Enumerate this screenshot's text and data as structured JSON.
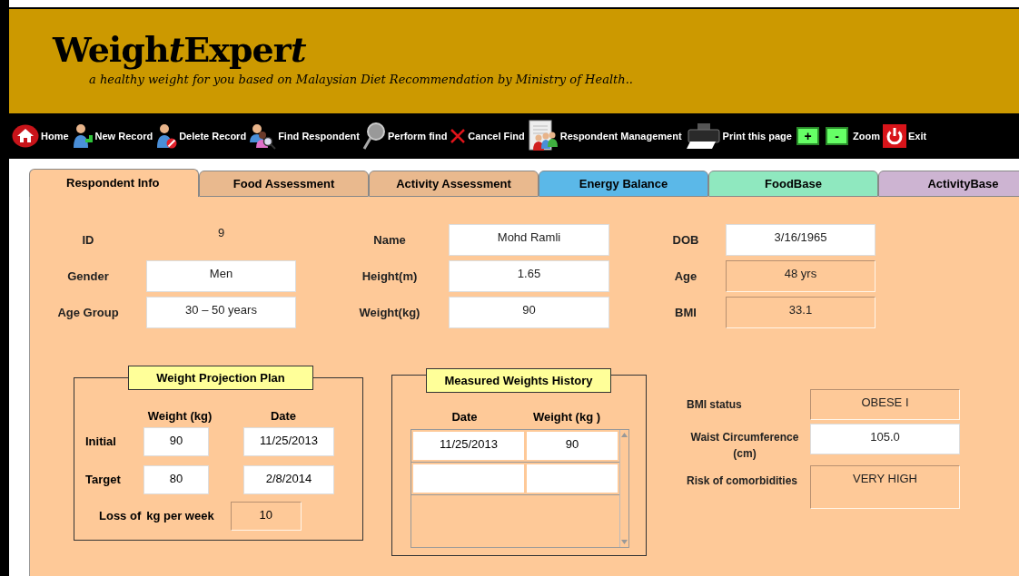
{
  "header": {
    "title_parts": [
      {
        "text": "Weigh",
        "italic": false
      },
      {
        "text": "t",
        "italic": true
      },
      {
        "text": "Exper",
        "italic": false
      },
      {
        "text": "t",
        "italic": true
      }
    ],
    "tagline": "a healthy weight for you based on Malaysian Diet Recommendation by Ministry of Health.."
  },
  "toolbar": [
    {
      "kind": "home",
      "label": "Home"
    },
    {
      "kind": "new",
      "label": "New Record"
    },
    {
      "kind": "delete",
      "label": "Delete Record"
    },
    {
      "kind": "find",
      "label": "Find Respondent"
    },
    {
      "kind": "perform",
      "label": "Perform find"
    },
    {
      "kind": "cancel",
      "label": "Cancel Find"
    },
    {
      "kind": "manage",
      "label": "Respondent Management"
    },
    {
      "kind": "print",
      "label": "Print this page"
    },
    {
      "kind": "zoom-in",
      "label": "+"
    },
    {
      "kind": "zoom-out",
      "label": "-"
    },
    {
      "kind": "text",
      "label": "Zoom"
    },
    {
      "kind": "exit",
      "label": "Exit"
    }
  ],
  "tabs": [
    {
      "label": "Respondent Info",
      "selected": true,
      "color": "#fec998"
    },
    {
      "label": "Food Assessment",
      "selected": false,
      "color": "#e9b98e"
    },
    {
      "label": "Activity Assessment",
      "selected": false,
      "color": "#e9b98e"
    },
    {
      "label": "Energy Balance",
      "selected": false,
      "color": "#5bb8e8"
    },
    {
      "label": "FoodBase",
      "selected": false,
      "color": "#8fe8bf"
    },
    {
      "label": "ActivityBase",
      "selected": false,
      "color": "#cdb4d2"
    }
  ],
  "respondent": [
    [
      {
        "label": "ID",
        "value": "9",
        "kind": "plain"
      },
      {
        "label": "Gender",
        "value": "Men",
        "kind": "input"
      },
      {
        "label": "Age Group",
        "value": "30 – 50 years",
        "kind": "input"
      }
    ],
    [
      {
        "label": "Name",
        "value": "Mohd Ramli",
        "kind": "input"
      },
      {
        "label": "Height(m)",
        "value": "1.65",
        "kind": "input"
      },
      {
        "label": "Weight(kg)",
        "value": "90",
        "kind": "input"
      }
    ],
    [
      {
        "label": "DOB",
        "value": "3/16/1965",
        "kind": "input"
      },
      {
        "label": "Age",
        "value": "48 yrs",
        "kind": "readonly"
      },
      {
        "label": "BMI",
        "value": "33.1",
        "kind": "readonly"
      }
    ]
  ],
  "weight_projection": {
    "title": "Weight Projection Plan",
    "columns": [
      "Weight (kg)",
      "Date"
    ],
    "rows": [
      {
        "label": "Initial",
        "weight": "90",
        "date": "11/25/2013"
      },
      {
        "label": "Target",
        "weight": "80",
        "date": "2/8/2014"
      }
    ],
    "loss": {
      "label": "Loss of",
      "unit": "kg per week",
      "value": "10"
    }
  },
  "weights_history": {
    "title": "Measured Weights History",
    "columns": [
      "Date",
      "Weight (kg )"
    ],
    "rows": [
      {
        "date": "11/25/2013",
        "weight": "90"
      }
    ]
  },
  "assessment": [
    {
      "label": "BMI status",
      "value": "OBESE I",
      "kind": "readonly"
    },
    {
      "label": "Waist Circumference (cm)",
      "value": "105.0",
      "kind": "input"
    },
    {
      "label": "Risk of comorbidities",
      "value": "VERY HIGH",
      "kind": "readonly"
    }
  ]
}
